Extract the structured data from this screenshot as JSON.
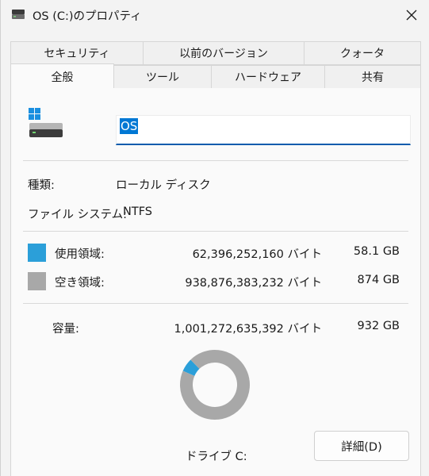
{
  "window": {
    "title": "OS (C:)のプロパティ",
    "close_icon": "close-icon"
  },
  "tabs_row1": [
    "セキュリティ",
    "以前のバージョン",
    "クォータ"
  ],
  "tabs_row2": [
    "全般",
    "ツール",
    "ハードウェア",
    "共有"
  ],
  "active_tab": "全般",
  "general": {
    "drive_name": "OS",
    "type_label": "種類:",
    "type_value": "ローカル ディスク",
    "fs_label": "ファイル システム:",
    "fs_value": "NTFS",
    "used_label": "使用領域:",
    "used_bytes": "62,396,252,160 バイト",
    "used_size": "58.1 GB",
    "free_label": "空き領域:",
    "free_bytes": "938,876,383,232 バイト",
    "free_size": "874 GB",
    "capacity_label": "容量:",
    "capacity_bytes": "1,001,272,635,392 バイト",
    "capacity_size": "932 GB",
    "drive_label": "ドライブ C:",
    "details_button": "詳細(D)"
  },
  "colors": {
    "used": "#2b9fd9",
    "free": "#a8a8a8",
    "accent": "#0078d4"
  },
  "chart_data": {
    "type": "pie",
    "categories": [
      "使用領域",
      "空き領域"
    ],
    "values": [
      62396252160,
      938876383232
    ],
    "title": "ドライブ C:"
  }
}
